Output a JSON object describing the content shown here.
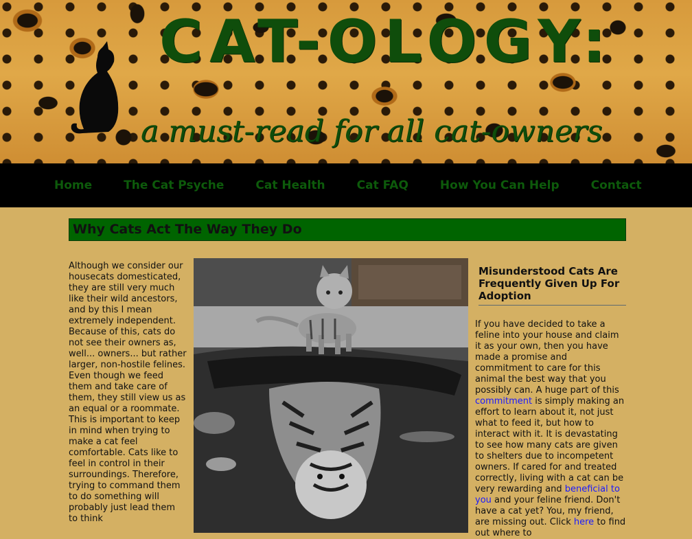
{
  "banner": {
    "title": "CAT-OLOGY:",
    "tagline": "a must-read for all cat-owners"
  },
  "nav": {
    "items": [
      {
        "label": "Home"
      },
      {
        "label": "The Cat Psyche"
      },
      {
        "label": "Cat Health"
      },
      {
        "label": "Cat FAQ"
      },
      {
        "label": "How You Can Help"
      },
      {
        "label": "Contact"
      }
    ]
  },
  "main": {
    "heading": "Why Cats Act The Way They Do",
    "left_paragraph_1": "Although we consider our housecats domesticated, they are still very much like their wild ancestors, and by this I mean extremely independent. Because of this, cats do not see their owners as, well... owners... but rather larger, non-hostile felines.",
    "left_paragraph_2": "Even though we feed them and take care of them, they still view us as an equal or a roommate. This is important to keep in mind when trying to make a cat feel comfortable. Cats like to feel in control in their surroundings. Therefore, trying to command them to do something will probably just lead them to think"
  },
  "sidebar": {
    "heading": "Misunderstood Cats Are Frequently Given Up For Adoption",
    "text_1": "If you have decided to take a feline into your house and claim it as your own, then you have made a promise and commitment to care for this animal the best way that you possibly can. A huge part of this ",
    "link_1": "commitment",
    "text_2": " is simply making an effort to learn about it, not just what to feed it, but how to interact with it. It is devastating to see how many cats are given to shelters due to incompetent owners. If cared for and treated correctly, living with a cat can be very rewarding and ",
    "link_2": "beneficial to you",
    "text_3": " and your feline friend. Don't have a cat yet? You, my friend, are missing out. Click ",
    "link_3": "here",
    "text_4": " to find out where to"
  },
  "colors": {
    "page_background": "#d4b063",
    "nav_background": "#000000",
    "nav_link": "#0d5a0b",
    "heading_bar": "#006400",
    "link": "#1a1aff"
  }
}
